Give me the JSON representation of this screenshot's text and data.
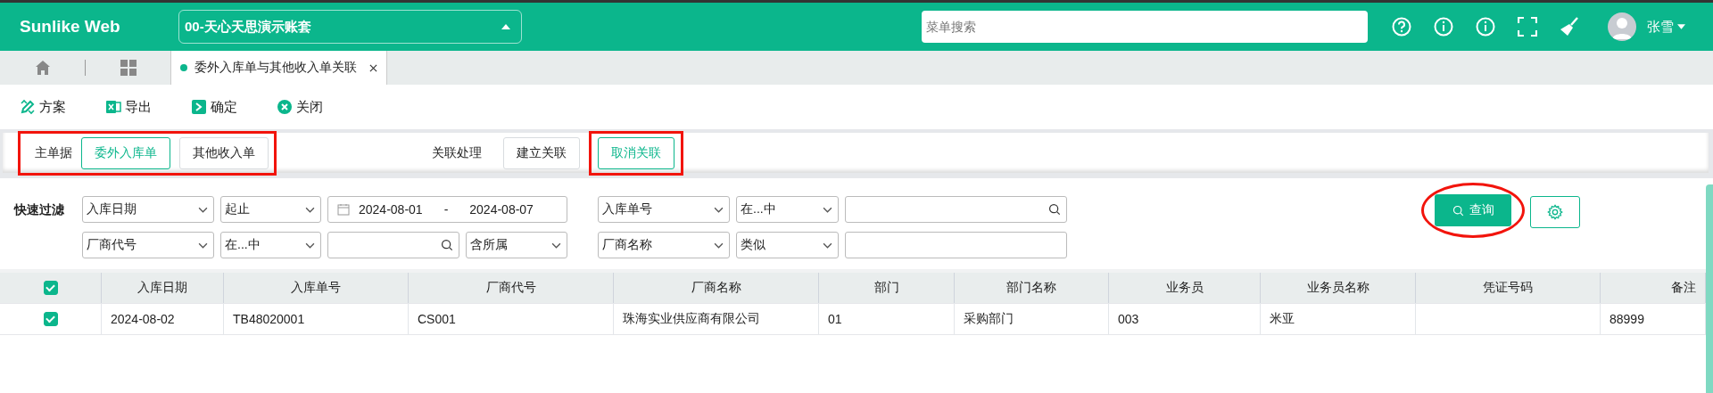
{
  "header": {
    "logo": "Sunlike Web",
    "account": "00-天心天思演示账套",
    "search": {
      "placeholder": "菜单搜索"
    },
    "user": "张雪"
  },
  "tabs": [
    {
      "label": "委外入库单与其他收入单关联",
      "selected": true
    }
  ],
  "toolbar": [
    {
      "label": "方案",
      "kind": "scheme"
    },
    {
      "label": "导出",
      "kind": "excel"
    },
    {
      "label": "确定",
      "kind": "confirm"
    },
    {
      "label": "关闭",
      "kind": "close"
    }
  ],
  "master": {
    "label": "主单据",
    "highlighted": true,
    "options": [
      {
        "label": "委外入库单",
        "selected": true
      },
      {
        "label": "其他收入单",
        "selected": false
      }
    ]
  },
  "link": {
    "label": "关联处理",
    "buttons": [
      {
        "label": "建立关联",
        "selected": false,
        "highlighted": false
      },
      {
        "label": "取消关联",
        "selected": true,
        "highlighted": true
      }
    ]
  },
  "filter": {
    "label": "快速过滤",
    "rows": [
      [
        {
          "kind": "select",
          "value": "入库日期"
        },
        {
          "kind": "select",
          "value": "起止"
        },
        {
          "kind": "daterange",
          "from": "2024-08-01",
          "separator": "-",
          "to": "2024-08-07"
        },
        "",
        {
          "kind": "select",
          "value": "入库单号"
        },
        {
          "kind": "select",
          "value": "在...中"
        },
        {
          "kind": "search"
        }
      ],
      [
        {
          "kind": "select",
          "value": "厂商代号"
        },
        {
          "kind": "select",
          "value": "在...中"
        },
        {
          "kind": "search"
        },
        {
          "kind": "select",
          "value": "含所属"
        },
        {
          "kind": "select",
          "value": "厂商名称"
        },
        {
          "kind": "select",
          "value": "类似"
        },
        {
          "kind": "input"
        }
      ]
    ]
  },
  "query": {
    "label": "查询",
    "highlighted": true
  },
  "table": {
    "all_checked": true,
    "columns": [
      "入库日期",
      "入库单号",
      "厂商代号",
      "厂商名称",
      "部门",
      "部门名称",
      "业务员",
      "业务员名称",
      "凭证号码",
      "备注"
    ],
    "rows": [
      {
        "checked": true,
        "cells": [
          "2024-08-02",
          "TB48020001",
          "CS001",
          "珠海实业供应商有限公司",
          "01",
          "采购部门",
          "003",
          "米亚",
          "",
          "88999"
        ]
      }
    ]
  }
}
